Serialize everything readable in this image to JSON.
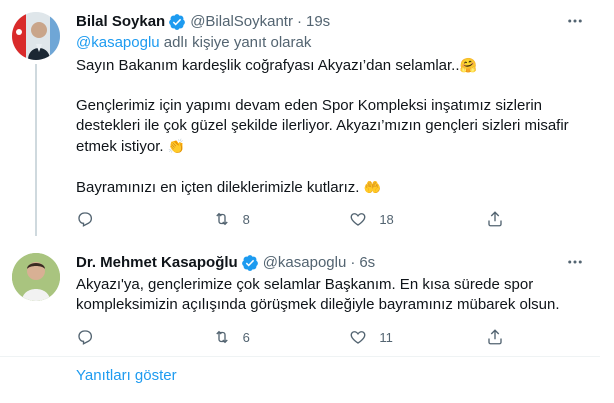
{
  "tweets": [
    {
      "name": "Bilal Soykan",
      "handle": "@BilalSoykantr",
      "time": "19s",
      "reply_prefix": "@kasapoglu",
      "reply_suffix": " adlı kişiye yanıt olarak",
      "paragraphs": [
        "Sayın Bakanım kardeşlik coğrafyası Akyazı’dan selamlar..",
        "Gençlerimiz için yapımı devam eden Spor Kompleksi inşatımız sizlerin destekleri ile çok güzel şekilde ilerliyor. Akyazı’mızın gençleri sizleri misafir etmek istiyor.",
        "Bayramınızı en içten dileklerimizle kutlarız."
      ],
      "emojis": [
        "🤗",
        "👏",
        "🤲"
      ],
      "replies": "",
      "retweets": "8",
      "likes": "18"
    },
    {
      "name": "Dr. Mehmet Kasapoğlu",
      "handle": "@kasapoglu",
      "time": "6s",
      "text": "Akyazı'ya, gençlerimize çok selamlar Başkanım. En kısa sürede spor kompleksimizin açılışında görüşmek dileğiyle bayramınız mübarek olsun.",
      "replies": "",
      "retweets": "6",
      "likes": "11"
    }
  ],
  "separator": "·",
  "show_replies": "Yanıtları göster",
  "colors": {
    "accent": "#1d9bf0",
    "text": "#0f1419",
    "muted": "#536471"
  }
}
